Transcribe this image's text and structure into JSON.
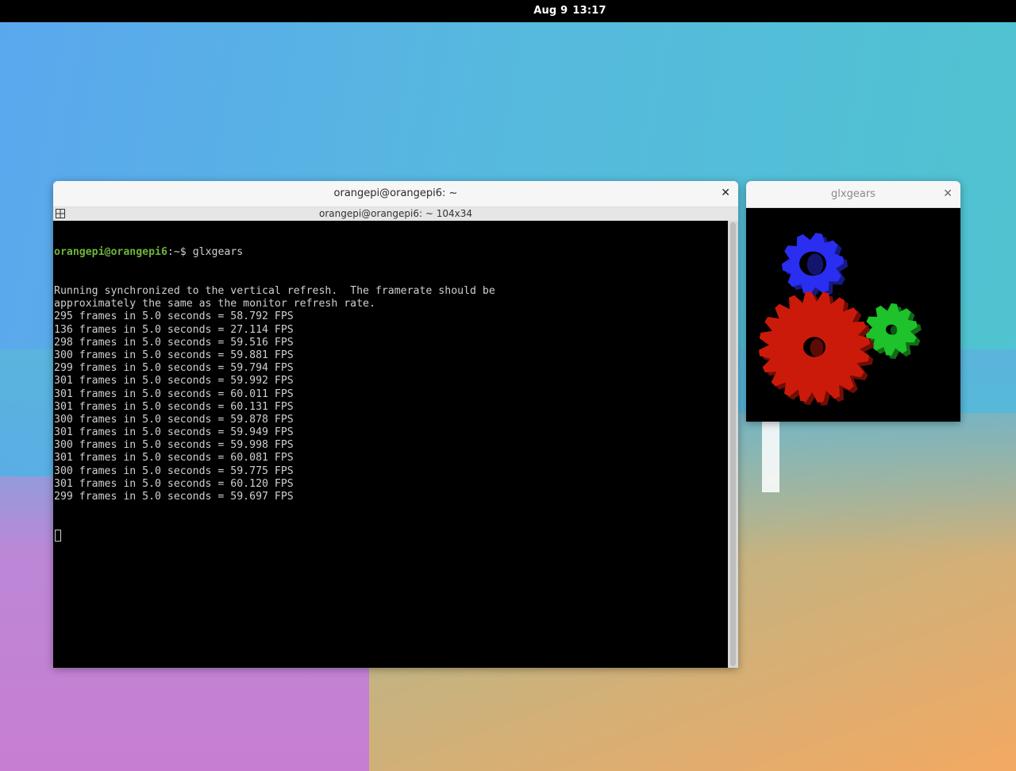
{
  "topbar": {
    "date": "Aug 9",
    "time": "13:17"
  },
  "terminal": {
    "window_title": "orangepi@orangepi6: ~",
    "tab_title": "orangepi@orangepi6: ~ 104x34",
    "prompt_user": "orangepi@orangepi6",
    "prompt_suffix": ":~$ ",
    "command": "glxgears",
    "output": [
      "Running synchronized to the vertical refresh.  The framerate should be",
      "approximately the same as the monitor refresh rate.",
      "295 frames in 5.0 seconds = 58.792 FPS",
      "136 frames in 5.0 seconds = 27.114 FPS",
      "298 frames in 5.0 seconds = 59.516 FPS",
      "300 frames in 5.0 seconds = 59.881 FPS",
      "299 frames in 5.0 seconds = 59.794 FPS",
      "301 frames in 5.0 seconds = 59.992 FPS",
      "301 frames in 5.0 seconds = 60.011 FPS",
      "301 frames in 5.0 seconds = 60.131 FPS",
      "300 frames in 5.0 seconds = 59.878 FPS",
      "301 frames in 5.0 seconds = 59.949 FPS",
      "300 frames in 5.0 seconds = 59.998 FPS",
      "301 frames in 5.0 seconds = 60.081 FPS",
      "300 frames in 5.0 seconds = 59.775 FPS",
      "301 frames in 5.0 seconds = 60.120 FPS",
      "299 frames in 5.0 seconds = 59.697 FPS"
    ],
    "colors": {
      "background": "#000000",
      "text": "#cfcfcf",
      "prompt": "#6fb43a"
    }
  },
  "glxgears": {
    "window_title": "glxgears",
    "gear_colors": {
      "red": "#cc1a0a",
      "green": "#1ec22a",
      "blue": "#2a2ef0"
    }
  }
}
